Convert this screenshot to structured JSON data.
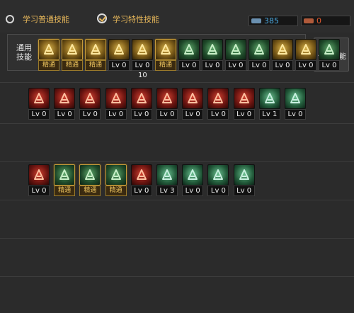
{
  "tabs": {
    "normal_label": "学习普通技能",
    "special_label": "学习特性技能",
    "selected": "special"
  },
  "points": {
    "sp": "385",
    "tp": "0",
    "sp_color": "#4aa8e0",
    "tp_color": "#e05a30"
  },
  "common": {
    "label": "通用技能",
    "skills": [
      {
        "icon": "meditate-icon",
        "level": "精通",
        "learned": true,
        "tint": "gold"
      },
      {
        "icon": "dash-icon",
        "level": "精通",
        "learned": true,
        "tint": "gold"
      },
      {
        "icon": "jump-icon",
        "level": "精通",
        "learned": true,
        "tint": "gold"
      },
      {
        "icon": "wings-icon",
        "level": "Lv 0",
        "learned": false,
        "tint": "gold"
      },
      {
        "icon": "eagle-icon",
        "level": "Lv 0",
        "learned": false,
        "tint": "gold"
      },
      {
        "icon": "feather-icon",
        "level": "精通",
        "learned": true,
        "tint": "gold"
      },
      {
        "icon": "target-icon",
        "level": "Lv 0",
        "learned": false,
        "tint": "green"
      },
      {
        "icon": "burst-icon",
        "level": "Lv 0",
        "learned": false,
        "tint": "green"
      },
      {
        "icon": "figure-icon",
        "level": "Lv 0",
        "learned": false,
        "tint": "green"
      },
      {
        "icon": "runner-icon",
        "level": "Lv 0",
        "learned": false,
        "tint": "green"
      },
      {
        "icon": "eye-icon",
        "level": "Lv 0",
        "learned": false,
        "tint": "gold"
      },
      {
        "icon": "warrior-icon",
        "level": "Lv 0",
        "learned": false,
        "tint": "gold"
      },
      {
        "icon": "blade-icon",
        "level": "Lv 0",
        "learned": false,
        "tint": "green"
      }
    ],
    "count": "10"
  },
  "steal_button": {
    "label": "偷学技能"
  },
  "class_row_1": {
    "skills": [
      {
        "icon": "sword-slash-icon",
        "level": "Lv 0",
        "tint": "red"
      },
      {
        "icon": "axe-icon",
        "level": "Lv 0",
        "tint": "red"
      },
      {
        "icon": "claw-icon",
        "level": "Lv 0",
        "tint": "red"
      },
      {
        "icon": "flame-sword-icon",
        "level": "Lv 0",
        "tint": "red"
      },
      {
        "icon": "leaf-blade-icon",
        "level": "Lv 0",
        "tint": "red"
      },
      {
        "icon": "explosion-icon",
        "level": "Lv 0",
        "tint": "red"
      },
      {
        "icon": "gun-icon",
        "level": "Lv 0",
        "tint": "red"
      },
      {
        "icon": "bomb-icon",
        "level": "Lv 0",
        "tint": "red"
      },
      {
        "icon": "fire-burst-icon",
        "level": "Lv 0",
        "tint": "red"
      },
      {
        "icon": "speed-icon",
        "level": "Lv 1",
        "tint": "teal"
      },
      {
        "icon": "kick-icon",
        "level": "Lv 0",
        "tint": "teal"
      }
    ]
  },
  "class_row_2": {
    "skills": [
      {
        "icon": "cannon-icon",
        "level": "Lv 0",
        "learned": false,
        "tint": "red"
      },
      {
        "icon": "eye-shot-icon",
        "level": "精通",
        "learned": true,
        "tint": "green"
      },
      {
        "icon": "spin-icon",
        "level": "精通",
        "learned": true,
        "tint": "green"
      },
      {
        "icon": "rifle-icon",
        "level": "精通",
        "learned": true,
        "tint": "green"
      },
      {
        "icon": "grenade-icon",
        "level": "Lv 0",
        "learned": false,
        "tint": "red"
      },
      {
        "icon": "launcher-icon",
        "level": "Lv 3",
        "learned": false,
        "tint": "teal"
      },
      {
        "icon": "gear-burst-icon",
        "level": "Lv 0",
        "learned": false,
        "tint": "teal"
      },
      {
        "icon": "vortex-icon",
        "level": "Lv 0",
        "learned": false,
        "tint": "teal"
      },
      {
        "icon": "cyclone-icon",
        "level": "Lv 0",
        "learned": false,
        "tint": "teal"
      }
    ]
  }
}
